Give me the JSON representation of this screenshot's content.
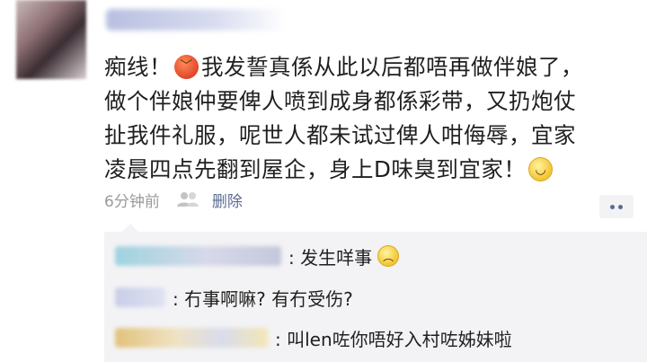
{
  "post": {
    "lines": [
      {
        "before": "痴线！",
        "emoji": "angry-face",
        "after": "我发誓真係从此以后都唔再做伴娘了，"
      },
      {
        "text": "做个伴娘仲要俾人喷到成身都係彩带，又扔炮仗"
      },
      {
        "text": "扯我件礼服，呢世人都未试过俾人咁侮辱，宜家"
      },
      {
        "before": "凌晨四点先翻到屋企，身上D味臭到宜家！",
        "emoji": "smile-face",
        "after": ""
      }
    ],
    "time": "6分钟前",
    "delete_label": "删除"
  },
  "comments": [
    {
      "text": ": 发生咩事",
      "emoji": "worried-face"
    },
    {
      "text": ": 冇事啊嘛? 有冇受伤?"
    },
    {
      "text": ": 叫len咗你唔好入村咗姊妹啦"
    }
  ],
  "colors": {
    "link": "#5b6b93",
    "meta_gray": "#9a9a9a",
    "comment_bg": "#f3f3f5"
  }
}
